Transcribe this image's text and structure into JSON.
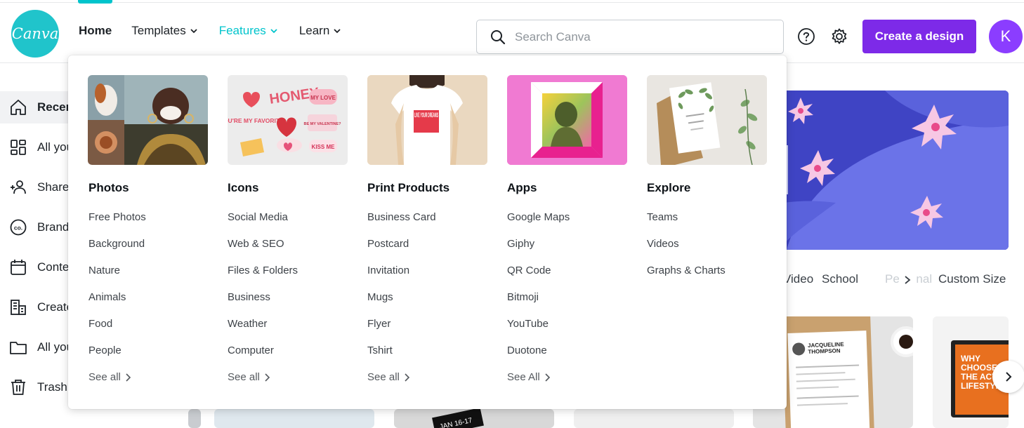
{
  "app": {
    "logo_text": "Canva"
  },
  "nav": {
    "home": "Home",
    "templates": "Templates",
    "features": "Features",
    "learn": "Learn"
  },
  "search": {
    "placeholder": "Search Canva"
  },
  "header": {
    "create_button": "Create a design",
    "avatar_letter": "K"
  },
  "sidebar": {
    "items": [
      {
        "label": "Recent",
        "icon": "home-icon"
      },
      {
        "label": "All your designs",
        "icon": "grid-icon"
      },
      {
        "label": "Shared with you",
        "icon": "people-icon"
      },
      {
        "label": "Brand Kit",
        "icon": "brand-icon"
      },
      {
        "label": "Content Planner",
        "icon": "calendar-icon"
      },
      {
        "label": "Create a team",
        "icon": "building-icon"
      },
      {
        "label": "All your folders",
        "icon": "folder-icon"
      },
      {
        "label": "Trash",
        "icon": "trash-icon"
      }
    ]
  },
  "main": {
    "categories": [
      "Video",
      "School",
      "Personal",
      "Custom Size"
    ],
    "resume_name": "JACQUELINE THOMPSON",
    "promo_text": "WHY CHOOSE THE ACT LIFESTYLE",
    "card_date": "JAN 16-17"
  },
  "features_menu": {
    "columns": [
      {
        "title": "Photos",
        "links": [
          "Free Photos",
          "Background",
          "Nature",
          "Animals",
          "Food",
          "People"
        ],
        "see_all": "See all"
      },
      {
        "title": "Icons",
        "links": [
          "Social Media",
          "Web & SEO",
          "Files & Folders",
          "Business",
          "Weather",
          "Computer"
        ],
        "see_all": "See all"
      },
      {
        "title": "Print Products",
        "links": [
          "Business Card",
          "Postcard",
          "Invitation",
          "Mugs",
          "Flyer",
          "Tshirt"
        ],
        "see_all": "See all"
      },
      {
        "title": "Apps",
        "links": [
          "Google Maps",
          "Giphy",
          "QR Code",
          "Bitmoji",
          "YouTube",
          "Duotone"
        ],
        "see_all": "See All"
      },
      {
        "title": "Explore",
        "links": [
          "Teams",
          "Videos",
          "Graphs & Charts"
        ]
      }
    ],
    "stickers": [
      "HONEY",
      "MY LOVE",
      "YOU'RE MY FAVORITE",
      "BE MY VALENTINE?",
      "KISS ME"
    ],
    "tshirt_text": "LIVE YOUR DREAMS"
  },
  "colors": {
    "accent": "#00c4cc",
    "primary_button": "#7d2ae8",
    "avatar": "#8b3dff",
    "logo": "#20c4cb"
  }
}
